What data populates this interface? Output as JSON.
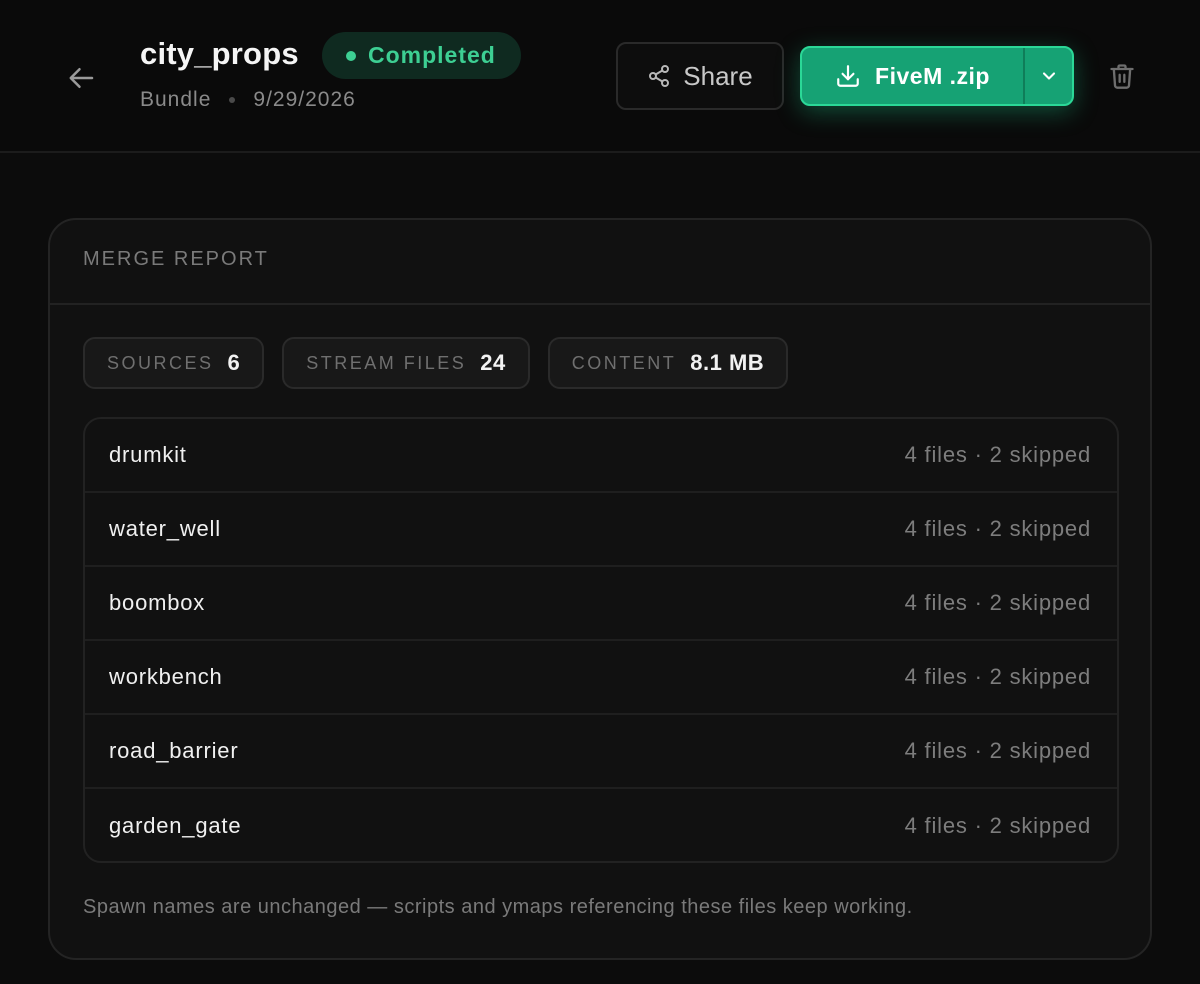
{
  "header": {
    "title": "city_props",
    "status": "Completed",
    "type": "Bundle",
    "date": "9/29/2026",
    "share_label": "Share",
    "download_label": "FiveM .zip"
  },
  "merge_report": {
    "heading": "MERGE REPORT",
    "stats": [
      {
        "label": "SOURCES",
        "value": "6"
      },
      {
        "label": "STREAM FILES",
        "value": "24"
      },
      {
        "label": "CONTENT",
        "value": "8.1 MB"
      }
    ],
    "sources": [
      {
        "name": "drumkit",
        "detail": "4 files · 2 skipped"
      },
      {
        "name": "water_well",
        "detail": "4 files · 2 skipped"
      },
      {
        "name": "boombox",
        "detail": "4 files · 2 skipped"
      },
      {
        "name": "workbench",
        "detail": "4 files · 2 skipped"
      },
      {
        "name": "road_barrier",
        "detail": "4 files · 2 skipped"
      },
      {
        "name": "garden_gate",
        "detail": "4 files · 2 skipped"
      }
    ],
    "footnote": "Spawn names are unchanged — scripts and ymaps referencing these files keep working."
  },
  "colors": {
    "accent": "#16a274",
    "status_text": "#3dcf93",
    "background": "#0c0c0c"
  },
  "icons": {
    "back": "arrow-left-icon",
    "share": "share-icon",
    "download": "download-icon",
    "caret": "chevron-down-icon",
    "delete": "trash-icon"
  }
}
